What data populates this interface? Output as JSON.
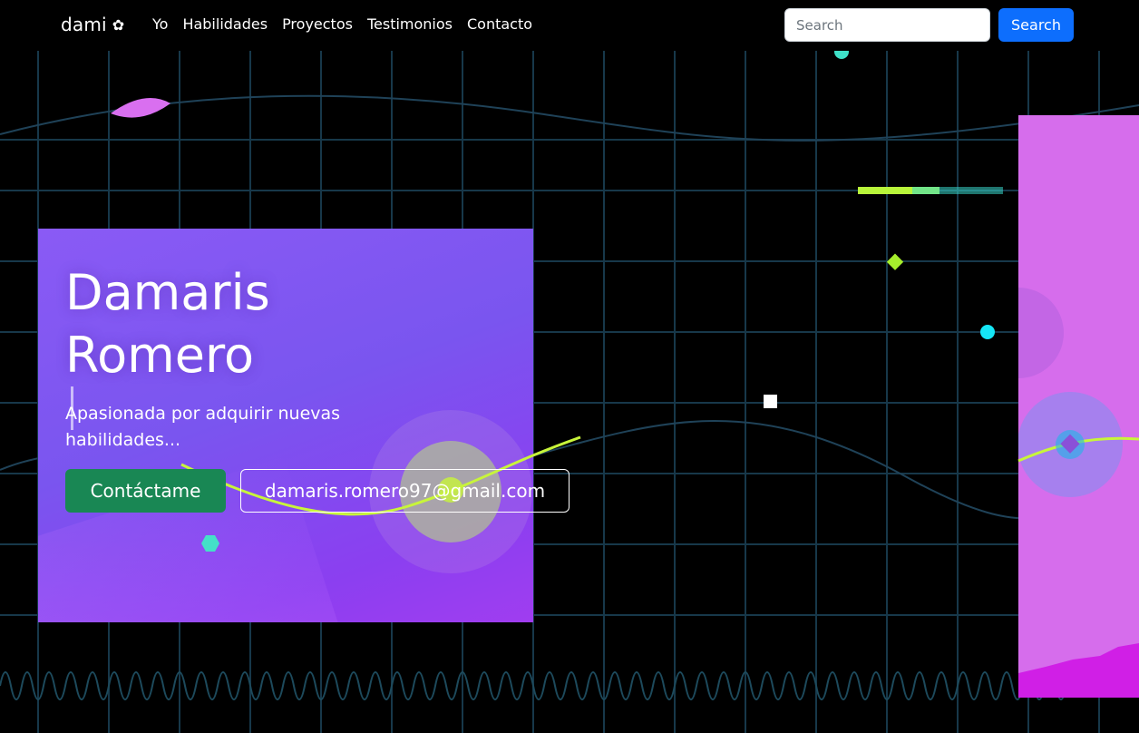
{
  "navbar": {
    "brand": "dami",
    "brand_icon": "✿",
    "links": [
      "Yo",
      "Habilidades",
      "Proyectos",
      "Testimonios",
      "Contacto"
    ],
    "search_placeholder": "Search",
    "search_button": "Search"
  },
  "hero": {
    "title_line1": "Damaris",
    "title_line2": "Romero",
    "subtitle": "Apasionada por adquirir nuevas habilidades...",
    "contact_button": "Contáctame",
    "email_button": "damaris.romero97@gmail.com"
  },
  "colors": {
    "background": "#000000",
    "card_purple": "#7a55ef",
    "panel_pink": "#d66dec",
    "contact_green": "#198754",
    "search_blue": "#0d6efd",
    "accent_lime": "#b8f53a",
    "accent_cyan": "#19e3f0"
  }
}
